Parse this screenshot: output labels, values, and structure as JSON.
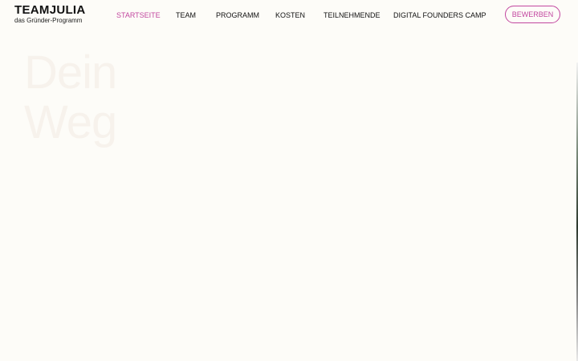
{
  "brand": {
    "title": "TEAMJULIA",
    "subtitle": "das Gründer-Programm"
  },
  "nav": {
    "items": [
      {
        "label": "STARTSEITE",
        "active": true
      },
      {
        "label": "TEAM",
        "active": false
      },
      {
        "label": "PROGRAMM",
        "active": false
      },
      {
        "label": "KOSTEN",
        "active": false
      },
      {
        "label": "TEILNEHMENDE",
        "active": false
      },
      {
        "label": "DIGITAL FOUNDERS CAMP",
        "active": false
      }
    ]
  },
  "cta": {
    "label": "BEWERBEN"
  },
  "hero": {
    "line1": "Dein",
    "line2": "Weg"
  },
  "colors": {
    "accent": "#c2469f",
    "background": "#fdfcf8",
    "text": "#111111",
    "hero_text": "#f7f2ec"
  }
}
